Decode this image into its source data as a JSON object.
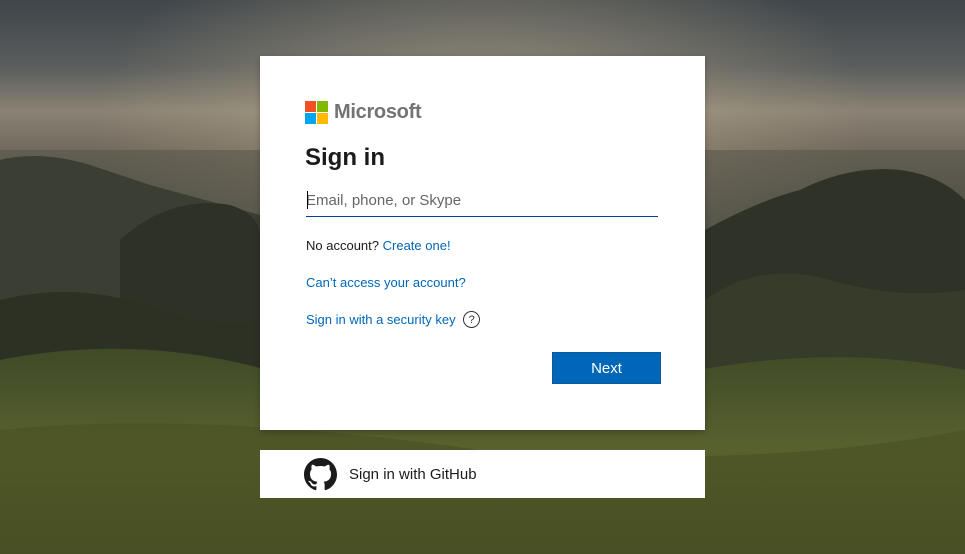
{
  "brand": {
    "name": "Microsoft",
    "logo_colors": [
      "#f25022",
      "#7fba00",
      "#00a4ef",
      "#ffb900"
    ]
  },
  "signin": {
    "title": "Sign in",
    "email_placeholder": "Email, phone, or Skype",
    "no_account_text": "No account?",
    "create_link": "Create one!",
    "cant_access_link": "Can’t access your account?",
    "security_key_link": "Sign in with a security key",
    "help_icon_glyph": "?",
    "next_label": "Next",
    "accent_color": "#0067b8"
  },
  "github": {
    "label": "Sign in with GitHub",
    "icon": "github-icon"
  }
}
